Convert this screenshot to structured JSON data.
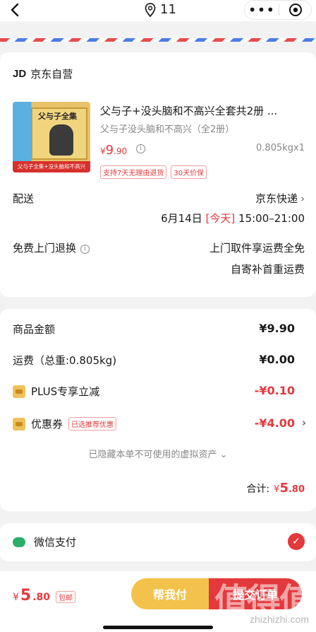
{
  "topbar": {
    "location_count": "11"
  },
  "shop": {
    "logo": "JD",
    "name": "京东自营"
  },
  "product": {
    "cover_title": "父与子全集",
    "cover_banner": "父与子全集+没头脑和不高兴",
    "title": "父与子+没头脑和不高兴全套共2册 ...",
    "subtitle": "父与子没头脑和不高兴（全2册）",
    "price_currency": "¥",
    "price_int": "9",
    "price_dec": ".90",
    "weight_qty": "0.805kgx1",
    "tags": [
      "支持7天无理由退货",
      "30天价保"
    ]
  },
  "delivery": {
    "label": "配送",
    "carrier": "京东快递",
    "date": "6月14日",
    "today": "[今天]",
    "time": "15:00–21:00"
  },
  "returns": {
    "label": "免费上门退换",
    "line1": "上门取件享运费全免",
    "line2": "自寄补首重运费"
  },
  "summary": {
    "items": [
      {
        "label": "商品金额",
        "value": "¥9.90",
        "red": false
      },
      {
        "label": "运费（总重:0.805kg)",
        "value": "¥0.00",
        "red": false
      }
    ],
    "plus_label": "PLUS专享立减",
    "plus_value": "-¥0.10",
    "coupon_label": "优惠券",
    "coupon_tag": "已选推荐优惠",
    "coupon_value": "-¥4.00",
    "hidden_assets": "已隐藏本单不可使用的虚拟资产",
    "total_label": "合计:",
    "total_currency": "¥",
    "total_int": "5",
    "total_dec": ".80"
  },
  "payment": {
    "method": "微信支付"
  },
  "bottom": {
    "currency": "¥",
    "int": "5",
    "dec": ".80",
    "shipping_tag": "包邮",
    "help_pay": "帮我付",
    "submit": "提交订单",
    "watermark": "值得值",
    "watermark_url": "zhizhizhi.com"
  },
  "colors": {
    "accent": "#e4393c",
    "help": "#f3c24b",
    "wechat": "#2aae67"
  }
}
